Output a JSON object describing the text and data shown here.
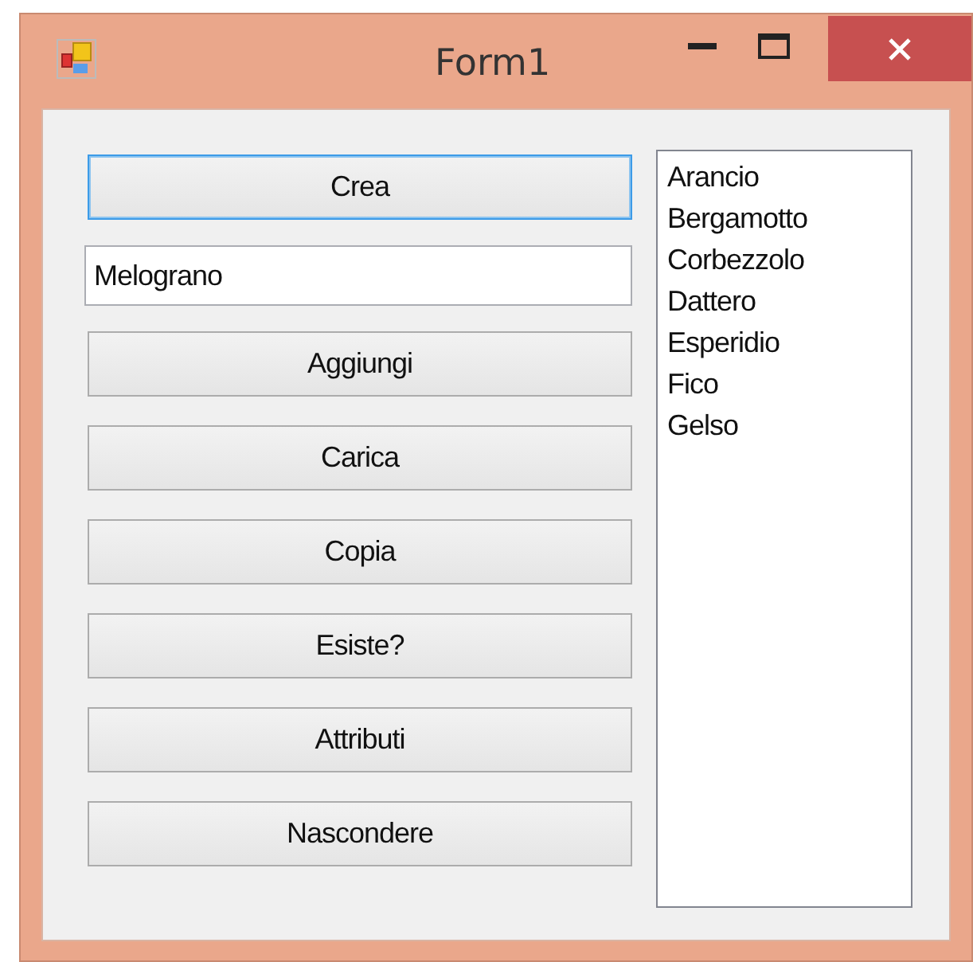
{
  "window": {
    "title": "Form1"
  },
  "buttons": [
    {
      "label": "Crea",
      "focused": true
    },
    {
      "label": "Aggiungi",
      "focused": false
    },
    {
      "label": "Carica",
      "focused": false
    },
    {
      "label": "Copia",
      "focused": false
    },
    {
      "label": "Esiste?",
      "focused": false
    },
    {
      "label": "Attributi",
      "focused": false
    },
    {
      "label": "Nascondere",
      "focused": false
    }
  ],
  "text_field": {
    "value": "Melograno"
  },
  "list": {
    "items": [
      "Arancio",
      "Bergamotto",
      "Corbezzolo",
      "Dattero",
      "Esperidio",
      "Fico",
      "Gelso"
    ]
  }
}
